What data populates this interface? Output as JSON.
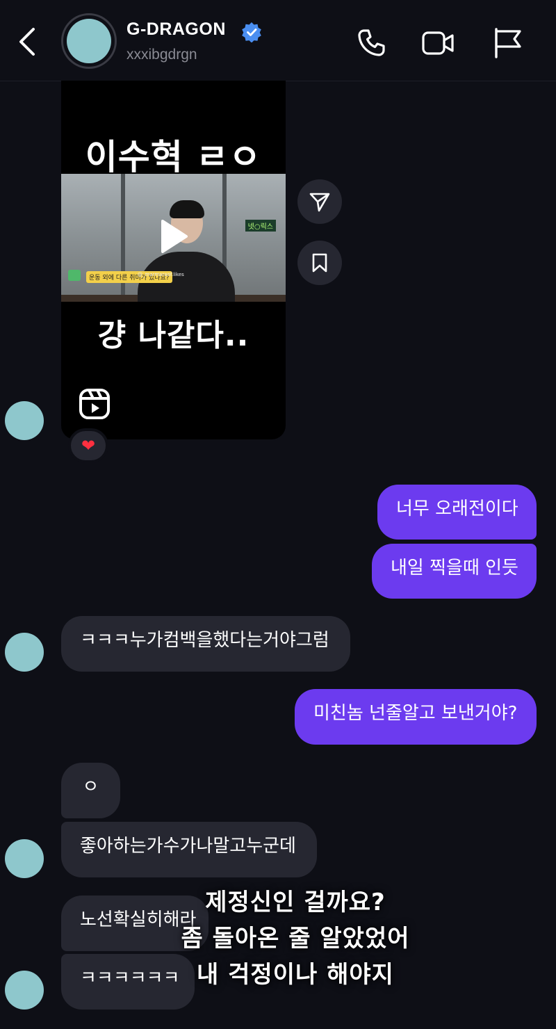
{
  "header": {
    "name": "G-DRAGON",
    "handle": "xxxibgdrgn",
    "verified": true
  },
  "reel": {
    "caption_top": "이수혁 ㄹㅇ",
    "caption_bottom": "걍 나같다..",
    "video_tags": [
      "넷○릭스",
      "운동 외에 다른 취미가 있나요?",
      "@_marmaraof.likes"
    ]
  },
  "reaction": "❤",
  "messages": [
    {
      "side": "out",
      "text": "너무 오래전이다"
    },
    {
      "side": "out",
      "text": "내일 찍을때 인듯"
    },
    {
      "side": "in",
      "text": "ㅋㅋㅋ누가컴백을했다는거야그럼"
    },
    {
      "side": "out",
      "text": "미친놈 넌줄알고 보낸거야?"
    },
    {
      "side": "in",
      "text": "ㅇ"
    },
    {
      "side": "in",
      "text": "좋아하는가수가나말고누군데"
    },
    {
      "side": "in",
      "text": "노선확실히해라"
    },
    {
      "side": "in",
      "text": "ㅋㅋㅋㅋㅋㅋ"
    }
  ],
  "overlay": {
    "line1": "제정신인 걸까요?",
    "line2": "좀 돌아온 줄 알았었어",
    "line3": "내 걱정이나 해야지"
  },
  "colors": {
    "background": "#0e0f16",
    "incoming_bubble": "#262731",
    "outgoing_bubble": "#6c3bef",
    "verified_badge": "#4a8ef0",
    "avatar": "#8ec7cc"
  }
}
